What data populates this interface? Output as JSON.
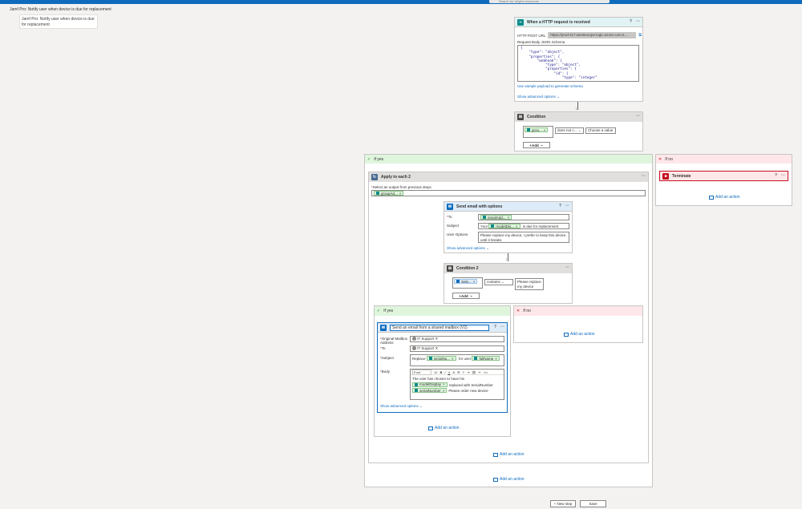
{
  "search": {
    "placeholder": "Search for helpful resources"
  },
  "flow": {
    "title": "Jamf Pro: Notify user when device is due for replacement",
    "title_box": "Jamf Pro: Notify user when device is due for replacement"
  },
  "trigger": {
    "title": "When a HTTP request is received",
    "url_label": "HTTP POST URL",
    "url_value": "https://prod-117.westeurope.logic.azure.com:4...",
    "schema_label": "Request Body JSON Schema",
    "schema_lines": [
      "{",
      "    \"type\": \"object\",",
      "    \"properties\": {",
      "        \"webhook\": {",
      "            \"type\": \"object\",",
      "            \"properties\": {",
      "                \"id\": {",
      "                    \"type\": \"integer\""
    ],
    "sample_link": "Use sample payload to generate schema",
    "advanced_link": "Show advanced options"
  },
  "condition1": {
    "title": "Condition",
    "token": "grou...",
    "operator": "does not c...",
    "value_placeholder": "Choose a value",
    "add_label": "Add"
  },
  "branch_yes": {
    "label": "If yes"
  },
  "branch_no": {
    "label": "If no"
  },
  "terminate": {
    "title": "Terminate"
  },
  "apply": {
    "title": "Apply to each 2",
    "select_label": "Select an output from previous steps",
    "token": "groupAd..."
  },
  "sendmail": {
    "title": "Send email with options",
    "to_label": "To",
    "to_token": "emailAdd...",
    "subject_label": "Subject",
    "subject_prefix": "Your",
    "subject_token": "modelDis...",
    "subject_suffix": "is due for replacement",
    "options_label": "User Options",
    "options_value": "Please replace my device, I prefer to keep this device until it breaks",
    "advanced_link": "Show advanced options"
  },
  "condition2": {
    "title": "Condition 2",
    "token": "Sele...",
    "operator": "contains",
    "value": "Please replace my device",
    "add_label": "Add"
  },
  "inner_yes": {
    "label": "If yes"
  },
  "inner_no": {
    "label": "If no"
  },
  "shared": {
    "title": "Send an email from a shared mailbox (V2)",
    "orig_label": "Original Mailbox Address",
    "orig_value": "IT Support",
    "to_label": "To",
    "to_value": "IT Support",
    "subject_label": "Subject",
    "subject_prefix": "Replace",
    "subject_token": "serialNu...",
    "subject_suffix": "for user",
    "subject_token2": "fullName",
    "body_label": "Body",
    "font_label": "Font",
    "font_size": "12",
    "body_line1": "The user has chosen to have his",
    "body_token1": "modelDisplay",
    "body_text1": "replaced with SerialNumber",
    "body_token2": "serialNumber",
    "body_text2": "Please order new device",
    "advanced_link": "Show advanced options"
  },
  "add_action": "Add an action",
  "bottom": {
    "new_step": "+ New step",
    "save": "Save"
  },
  "colors": {
    "accent": "#0f6cbd",
    "teal": "#0f8a8a",
    "yes": "#dff6dd",
    "no": "#fde7e9",
    "condition": "#484644",
    "outlook": "#0f6cbd",
    "terminate": "#c50f1f"
  }
}
